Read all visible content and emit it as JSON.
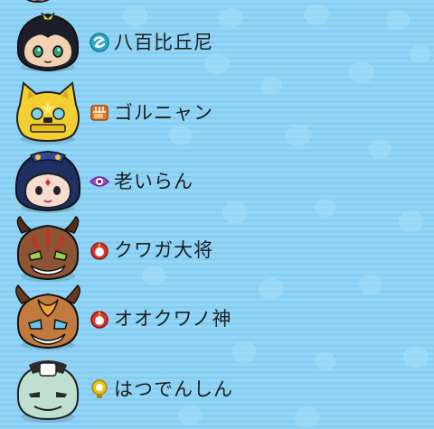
{
  "list": {
    "items": [
      {
        "name": "八百比丘尼",
        "attribute_icon": "water-swirl-icon",
        "attribute_color": "#2aa9c9",
        "face_icon": "yaokai-happoubikuni-face-icon",
        "face_color": "#f2d2b4"
      },
      {
        "name": "ゴルニャン",
        "attribute_icon": "fist-icon",
        "attribute_color": "#e07820",
        "face_icon": "yokai-gorunyan-face-icon",
        "face_color": "#f3cf34"
      },
      {
        "name": "老いらん",
        "attribute_icon": "eye-icon",
        "attribute_color": "#a54cc6",
        "face_icon": "yokai-oiran-face-icon",
        "face_color": "#f4dcd0"
      },
      {
        "name": "クワガ大将",
        "attribute_icon": "fire-ring-icon",
        "attribute_color": "#d6342c",
        "face_icon": "yokai-kuwaga-taishou-face-icon",
        "face_color": "#8f5433"
      },
      {
        "name": "オオクワノ神",
        "attribute_icon": "fire-ring-icon",
        "attribute_color": "#d6342c",
        "face_icon": "yokai-ookuwanokami-face-icon",
        "face_color": "#c27a3f"
      },
      {
        "name": "はつでんしん",
        "attribute_icon": "lightbulb-icon",
        "attribute_color": "#e8c21a",
        "face_icon": "yokai-hatsudenshin-face-icon",
        "face_color": "#bfe0d0"
      }
    ]
  },
  "colors": {
    "background": "#8fd3f5",
    "text": "#1d1d1d"
  }
}
